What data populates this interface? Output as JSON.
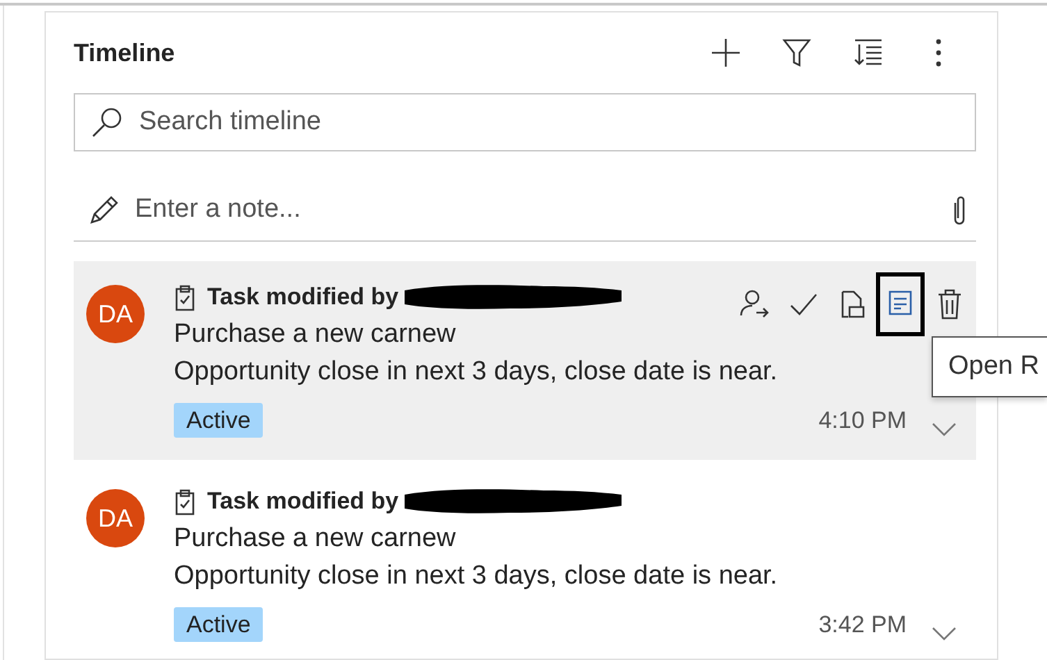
{
  "panel": {
    "title": "Timeline",
    "header_actions": [
      {
        "kind": "add"
      },
      {
        "kind": "filter"
      },
      {
        "kind": "sort"
      },
      {
        "kind": "more"
      }
    ]
  },
  "search": {
    "placeholder": "Search timeline"
  },
  "note": {
    "placeholder": "Enter a note..."
  },
  "items": [
    {
      "initials": "DA",
      "title": "Task modified by",
      "name_redacted": true,
      "subject": "Purchase a new carnew",
      "description": "Opportunity close in next 3 days, close date is near.",
      "status": "Active",
      "time": "4:10 PM",
      "hovered": true,
      "actions": [
        {
          "kind": "assign",
          "focused": false
        },
        {
          "kind": "complete",
          "focused": false
        },
        {
          "kind": "convert",
          "focused": false
        },
        {
          "kind": "open",
          "focused": true
        },
        {
          "kind": "delete",
          "focused": false
        }
      ]
    },
    {
      "initials": "DA",
      "title": "Task modified by",
      "name_redacted": true,
      "subject": "Purchase a new carnew",
      "description": "Opportunity close in next 3 days, close date is near.",
      "status": "Active",
      "time": "3:42 PM",
      "hovered": false
    }
  ],
  "tooltip": {
    "text": "Open R"
  }
}
